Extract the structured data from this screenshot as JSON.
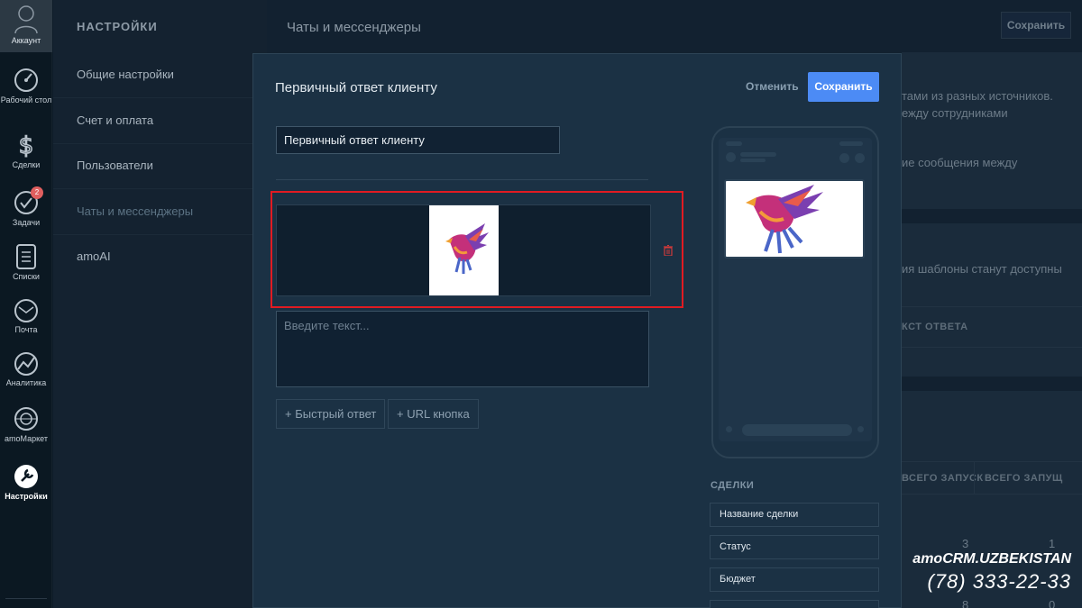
{
  "nav": {
    "account_label": "Аккаунт",
    "items": [
      {
        "label": "Рабочий стол",
        "icon": "dashboard-icon"
      },
      {
        "label": "Сделки",
        "icon": "dollar-icon"
      },
      {
        "label": "Задачи",
        "icon": "check-icon",
        "badge": "2"
      },
      {
        "label": "Списки",
        "icon": "list-icon"
      },
      {
        "label": "Почта",
        "icon": "mail-icon"
      },
      {
        "label": "Аналитика",
        "icon": "analytics-icon"
      },
      {
        "label": "amoМаркет",
        "icon": "market-icon"
      },
      {
        "label": "Настройки",
        "icon": "wrench-icon"
      }
    ]
  },
  "settings_sidebar": {
    "title": "НАСТРОЙКИ",
    "items": [
      {
        "label": "Общие настройки"
      },
      {
        "label": "Счет и оплата"
      },
      {
        "label": "Пользователи"
      },
      {
        "label": "Чаты и мессенджеры"
      },
      {
        "label": "amoAI"
      }
    ]
  },
  "main": {
    "title": "Чаты и мессенджеры",
    "save_label": "Сохранить",
    "bg_text1": "тами из разных источников.",
    "bg_text2": "ежду сотрудниками",
    "bg_text3": "ие сообщения между",
    "bg_text4": "ия шаблоны станут доступны",
    "bg_head1": "КСТ ОТВЕТА",
    "bg_head2": "ВСЕГО ЗАПУСК",
    "bg_head3": "ВСЕГО ЗАПУЩ",
    "bg_num1": "3",
    "bg_num2": "1",
    "bg_num3": "8",
    "bg_num4": "0"
  },
  "modal": {
    "title": "Первичный ответ клиенту",
    "cancel_label": "Отменить",
    "save_label": "Сохранить",
    "name_value": "Первичный ответ клиенту",
    "text_placeholder": "Введите текст...",
    "quick_reply_label": "+ Быстрый ответ",
    "url_button_label": "+ URL кнопка",
    "deals_title": "СДЕЛКИ",
    "tags": [
      "Название сделки",
      "Статус",
      "Бюджет"
    ]
  },
  "watermark": {
    "line1": "amoCRM.UZBEKISTAN",
    "line2": "(78) 333-22-33"
  },
  "colors": {
    "accent": "#4c8bf5",
    "highlight": "#e11b22",
    "badge": "#e05f5f"
  }
}
